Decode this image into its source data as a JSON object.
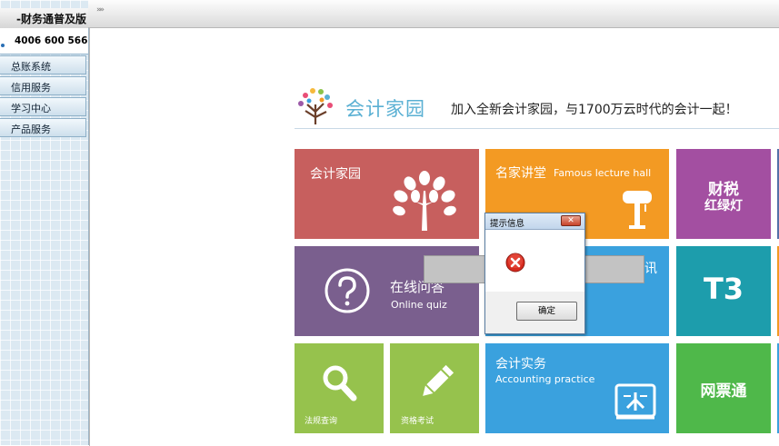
{
  "window": {
    "brand_title": "-财务通普及版",
    "phone": "4006 600 566",
    "collapse_glyph": "»»"
  },
  "sidebar": {
    "items": [
      {
        "label": "总账系统"
      },
      {
        "label": "信用服务"
      },
      {
        "label": "学习中心"
      },
      {
        "label": "产品服务"
      }
    ]
  },
  "header": {
    "logo_text": "会计家园",
    "slogan": "加入全新会计家园，与1700万云时代的会计一起！"
  },
  "tiles": {
    "home": {
      "title": "会计家园",
      "color": "#c75f5e",
      "icon": "tree-icon"
    },
    "lecture": {
      "title": "名家讲堂",
      "subtitle": "Famous lecture hall",
      "color": "#f39a23",
      "icon": "lectern-icon"
    },
    "tax": {
      "line1": "财税",
      "line2": "红绿灯",
      "color": "#a34fa1"
    },
    "qa": {
      "title": "在线问答",
      "subtitle": "Online quiz",
      "color": "#7a5f8e",
      "icon": "question-icon"
    },
    "news": {
      "title_fragment": "讯",
      "color": "#3aa1de"
    },
    "t3": {
      "label": "T3",
      "color": "#1d9dac"
    },
    "law": {
      "label": "法规查询",
      "color": "#96c24d",
      "icon": "search-icon"
    },
    "exam": {
      "label": "资格考试",
      "color": "#96c24d",
      "icon": "pencil-icon"
    },
    "practice": {
      "title": "会计实务",
      "subtitle": "Accounting practice",
      "color": "#3aa1de",
      "icon": "board-icon"
    },
    "ticket": {
      "label": "网票通",
      "color": "#4fb84a"
    }
  },
  "dialog": {
    "title": "提示信息",
    "close_glyph": "✕",
    "ok_label": "确定",
    "icon": "error-icon"
  }
}
